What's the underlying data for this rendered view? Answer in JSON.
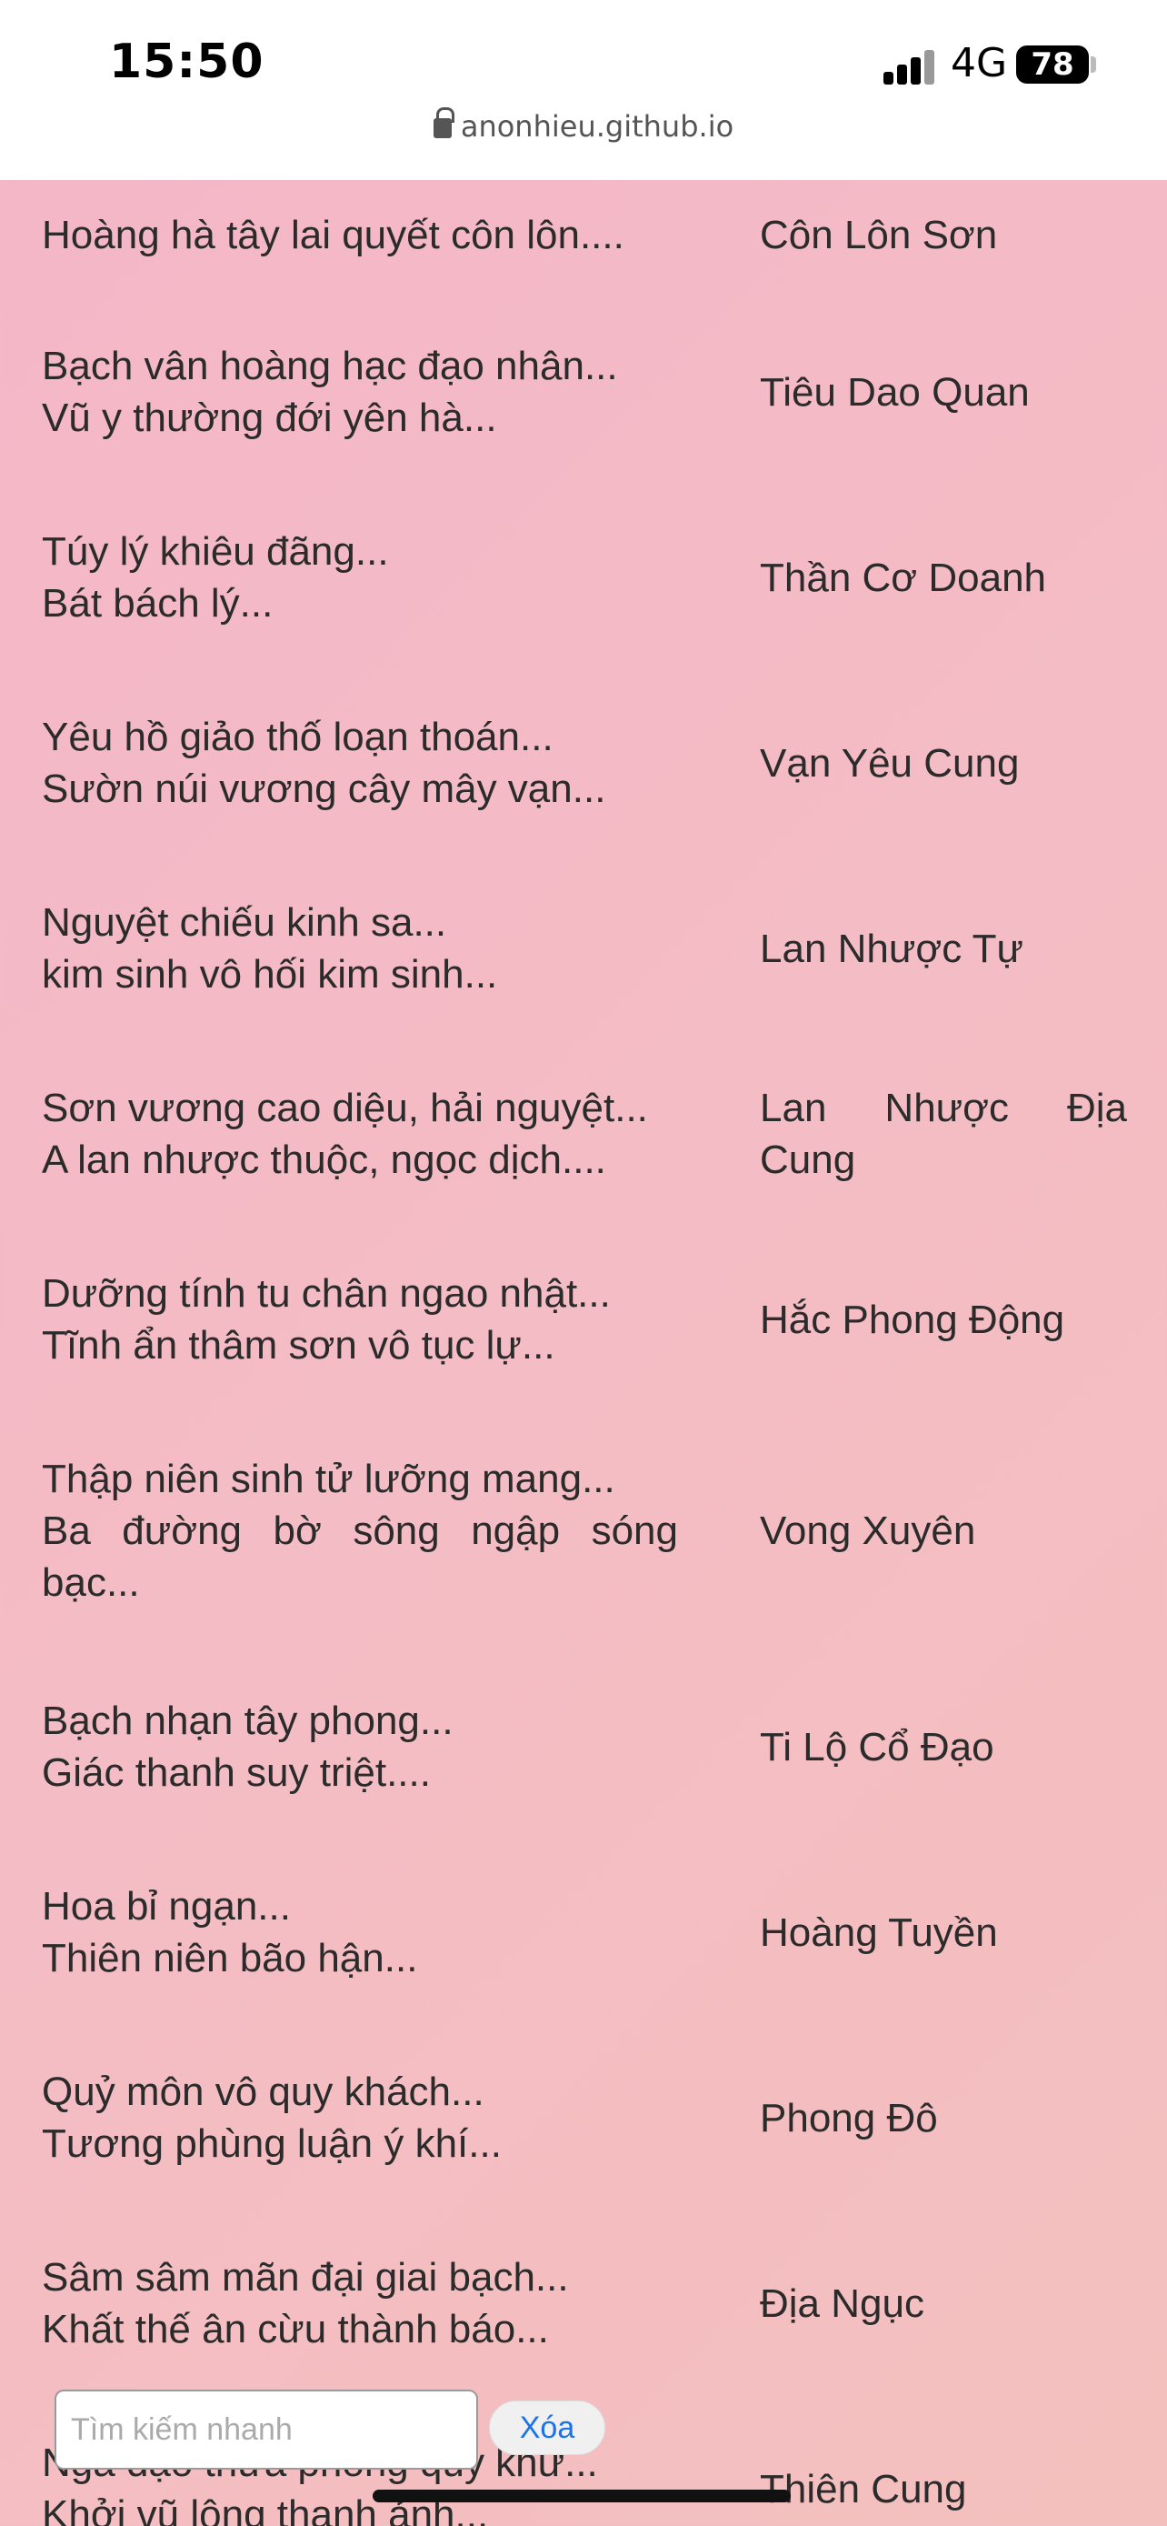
{
  "status": {
    "time": "15:50",
    "network": "4G",
    "battery": "78",
    "url": "anonhieu.github.io"
  },
  "rows": [
    {
      "lines": [
        "Hoàng hà tây lai quyết côn lôn...."
      ],
      "place": "Côn Lôn Sơn"
    },
    {
      "lines": [
        "Bạch vân hoàng hạc đạo nhân...",
        "Vũ y thường đới yên hà..."
      ],
      "place": "Tiêu Dao Quan"
    },
    {
      "lines": [
        "Túy lý khiêu đãng...",
        "Bát bách lý..."
      ],
      "place": "Thần Cơ Doanh"
    },
    {
      "lines": [
        "Yêu hồ giảo thố loạn thoán...",
        "Sườn núi vương cây mây vạn..."
      ],
      "place": "Vạn Yêu Cung"
    },
    {
      "lines": [
        "Nguyệt chiếu kinh sa...",
        "kim sinh vô hối kim sinh..."
      ],
      "place": "Lan Nhược Tự"
    },
    {
      "lines": [
        "Sơn vương cao diệu, hải nguyệt...",
        "A lan nhược thuộc, ngọc dịch...."
      ],
      "place": "Lan Nhược Địa Cung"
    },
    {
      "lines": [
        "Dưỡng tính tu chân ngao nhật...",
        "Tĩnh ẩn thâm sơn vô tục lự..."
      ],
      "place": "Hắc Phong Động"
    },
    {
      "lines": [
        "Thập niên sinh tử lưỡng mang...",
        "Ba đường bờ sông ngập sóng bạc..."
      ],
      "place": "Vong Xuyên"
    },
    {
      "lines": [
        "Bạch nhạn tây phong...",
        "Giác thanh suy triệt...."
      ],
      "place": "Ti Lộ Cổ Đạo"
    },
    {
      "lines": [
        "Hoa bỉ ngạn...",
        "Thiên niên bão hận..."
      ],
      "place": "Hoàng Tuyền"
    },
    {
      "lines": [
        "Quỷ môn vô quy khách...",
        "Tương phùng luận ý khí..."
      ],
      "place": "Phong Đô"
    },
    {
      "lines": [
        "Sâm sâm mãn đại giai bạch...",
        "Khất thế ân cừu thành báo..."
      ],
      "place": "Địa Ngục"
    },
    {
      "lines": [
        "Nga đạo thừa phong quy khứ...",
        "Khởi vũ lộng thanh ảnh..."
      ],
      "place": "Thiên Cung"
    }
  ],
  "search": {
    "placeholder": "Tìm kiếm nhanh",
    "clear_label": "Xóa"
  }
}
